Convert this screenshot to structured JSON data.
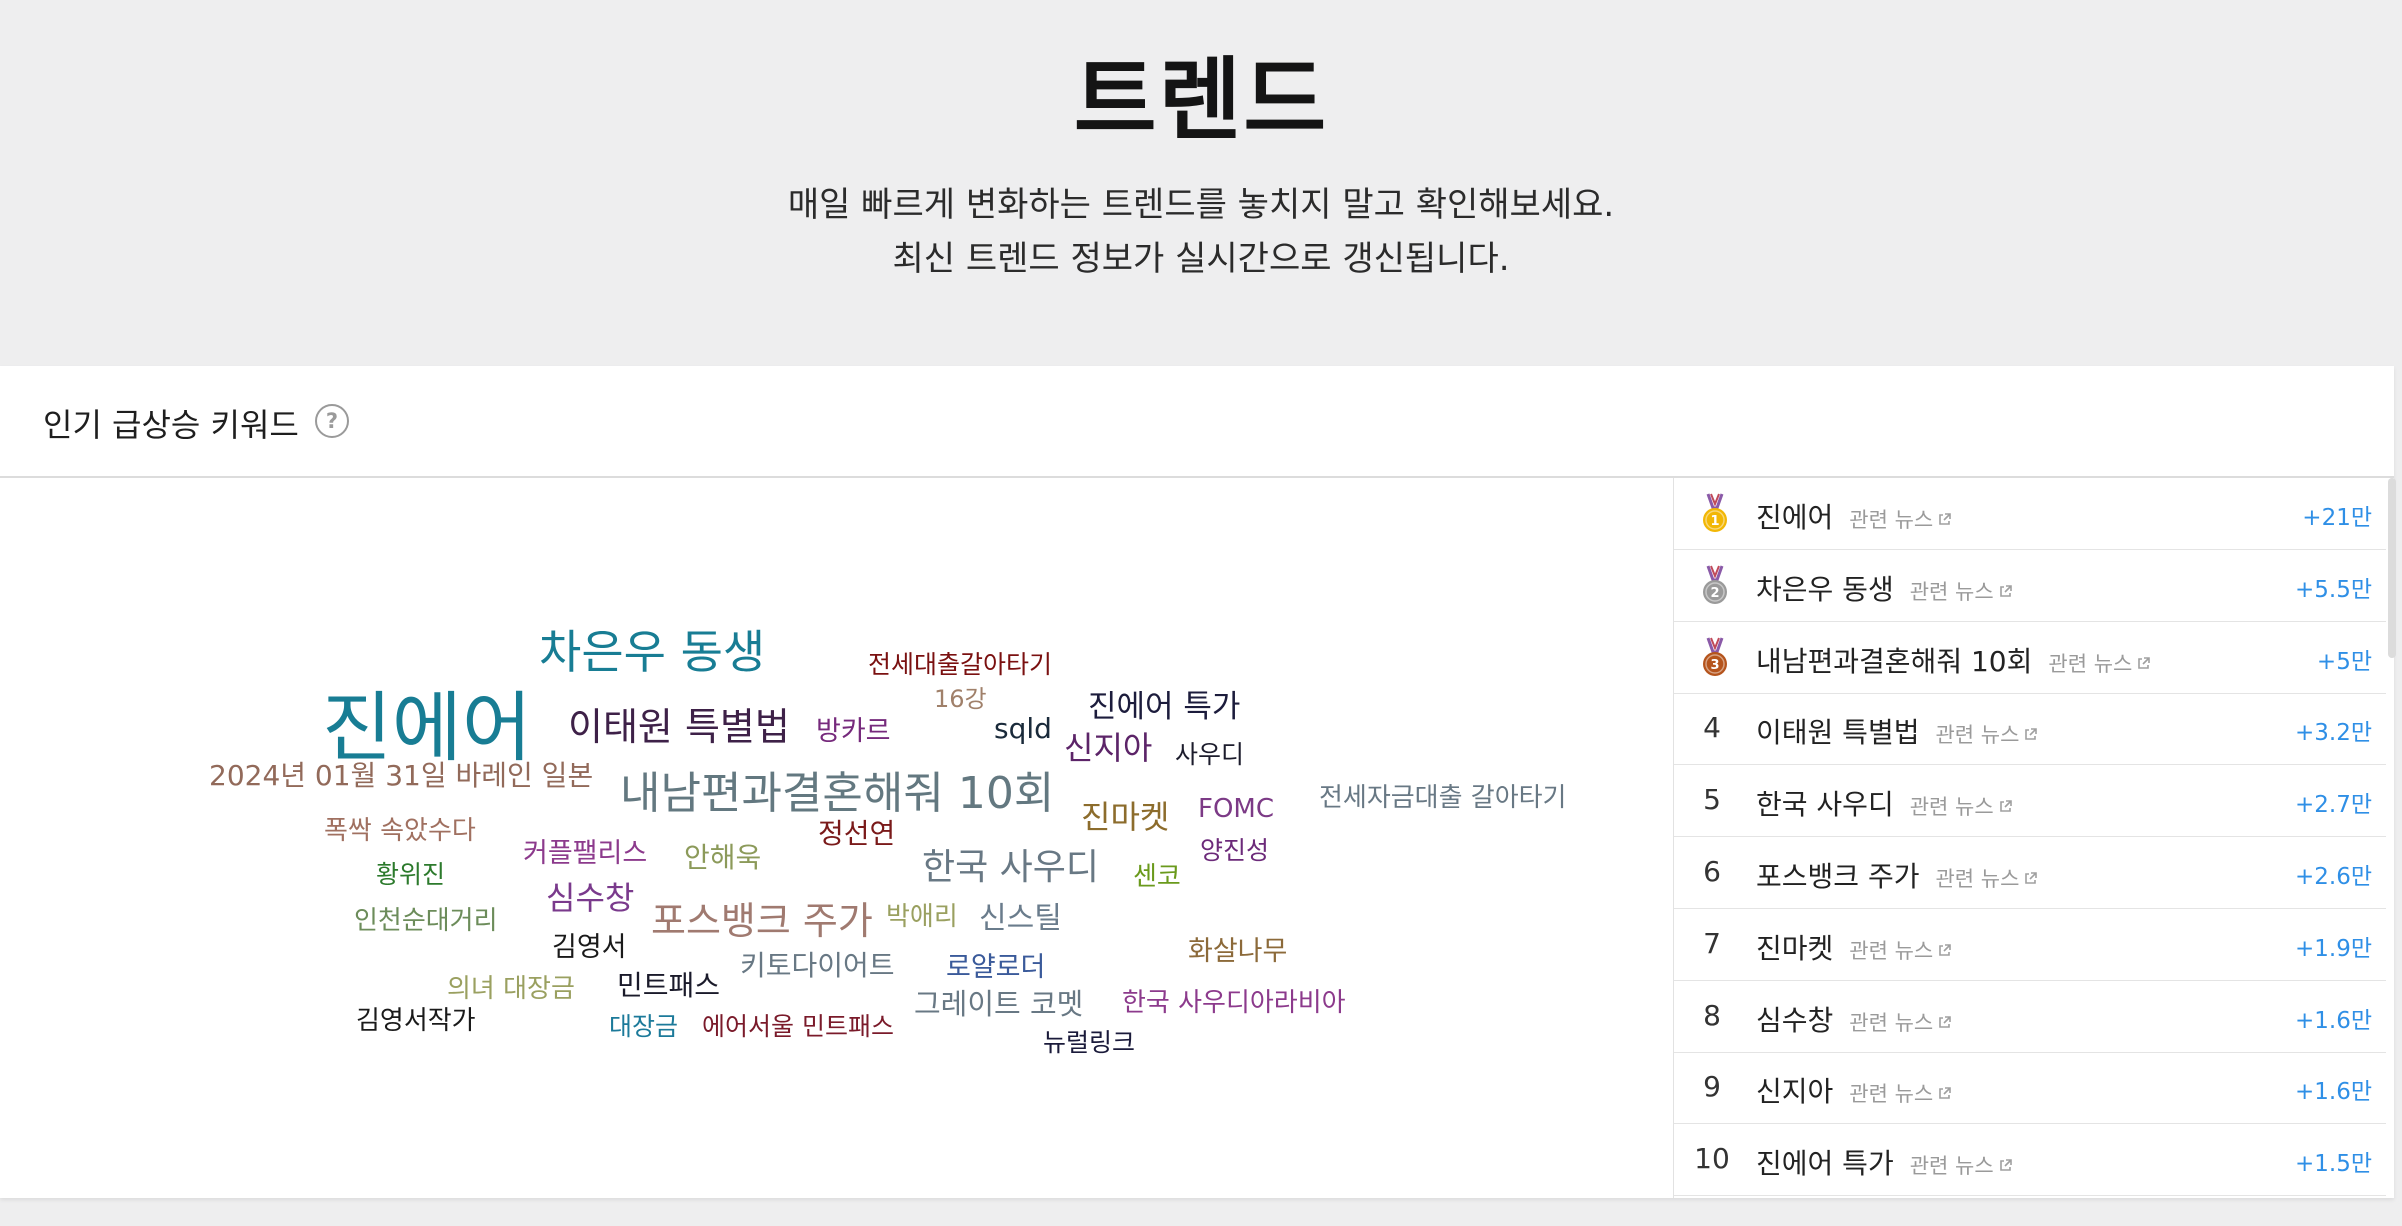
{
  "hero": {
    "title": "트렌드",
    "subtitle_line1": "매일 빠르게 변화하는 트렌드를 놓치지 말고 확인해보세요.",
    "subtitle_line2": "최신 트렌드 정보가 실시간으로 갱신됩니다."
  },
  "panel": {
    "title": "인기 급상승 키워드",
    "help_symbol": "?"
  },
  "word_cloud": [
    {
      "text": "진에어",
      "color": "#187d94"
    },
    {
      "text": "차은우 동생",
      "color": "#187d94"
    },
    {
      "text": "이태원 특별법",
      "color": "#3e2148"
    },
    {
      "text": "내남편과결혼해줘 10회",
      "color": "#637880"
    },
    {
      "text": "전세대출갈아타기",
      "color": "#7a1010"
    },
    {
      "text": "16강",
      "color": "#a0806a"
    },
    {
      "text": "sqld",
      "color": "#1a2a3a"
    },
    {
      "text": "진에어 특가",
      "color": "#1c1c3c"
    },
    {
      "text": "방카르",
      "color": "#762a7c"
    },
    {
      "text": "신지아",
      "color": "#5c2468"
    },
    {
      "text": "사우디",
      "color": "#1c1c2c"
    },
    {
      "text": "2024년 01월 31일 바레인 일본",
      "color": "#926a5a"
    },
    {
      "text": "진마켓",
      "color": "#8c6c2c"
    },
    {
      "text": "FOMC",
      "color": "#7c3a86"
    },
    {
      "text": "전세자금대출 갈아타기",
      "color": "#687884"
    },
    {
      "text": "폭싹 속았수다",
      "color": "#a07060"
    },
    {
      "text": "정선연",
      "color": "#7a1a1a"
    },
    {
      "text": "양진성",
      "color": "#6c2a7a"
    },
    {
      "text": "커플팰리스",
      "color": "#8c3a8c"
    },
    {
      "text": "안해욱",
      "color": "#8c9a5a"
    },
    {
      "text": "한국 사우디",
      "color": "#687884"
    },
    {
      "text": "황위진",
      "color": "#2c7a2c"
    },
    {
      "text": "센코",
      "color": "#6a9a1c"
    },
    {
      "text": "심수창",
      "color": "#7a3a8c"
    },
    {
      "text": "인천순대거리",
      "color": "#6c8c5a"
    },
    {
      "text": "포스뱅크 주가",
      "color": "#a07a70"
    },
    {
      "text": "박애리",
      "color": "#9aa060"
    },
    {
      "text": "신스틸",
      "color": "#6a7c8c"
    },
    {
      "text": "김영서",
      "color": "#1a1a1a"
    },
    {
      "text": "화살나무",
      "color": "#8c6a3a"
    },
    {
      "text": "키토다이어트",
      "color": "#687884"
    },
    {
      "text": "로얄로더",
      "color": "#3a5a9a"
    },
    {
      "text": "의녀 대장금",
      "color": "#9aa060"
    },
    {
      "text": "민트패스",
      "color": "#1a1a2a"
    },
    {
      "text": "그레이트 코멧",
      "color": "#687884"
    },
    {
      "text": "한국 사우디아라비아",
      "color": "#8c3a8c"
    },
    {
      "text": "김영서작가",
      "color": "#1a1a1a"
    },
    {
      "text": "대장금",
      "color": "#1c7a9a"
    },
    {
      "text": "에어서울 민트패스",
      "color": "#7a1a2a"
    },
    {
      "text": "뉴럴링크",
      "color": "#1a1a3a"
    }
  ],
  "ranking": [
    {
      "rank": "1",
      "medal": "gold-medal-icon",
      "name": "진에어",
      "news": "관련 뉴스",
      "change": "+21만"
    },
    {
      "rank": "2",
      "medal": "silver-medal-icon",
      "name": "차은우 동생",
      "news": "관련 뉴스",
      "change": "+5.5만"
    },
    {
      "rank": "3",
      "medal": "bronze-medal-icon",
      "name": "내남편과결혼해줘 10회",
      "news": "관련 뉴스",
      "change": "+5만"
    },
    {
      "rank": "4",
      "name": "이태원 특별법",
      "news": "관련 뉴스",
      "change": "+3.2만"
    },
    {
      "rank": "5",
      "name": "한국 사우디",
      "news": "관련 뉴스",
      "change": "+2.7만"
    },
    {
      "rank": "6",
      "name": "포스뱅크 주가",
      "news": "관련 뉴스",
      "change": "+2.6만"
    },
    {
      "rank": "7",
      "name": "진마켓",
      "news": "관련 뉴스",
      "change": "+1.9만"
    },
    {
      "rank": "8",
      "name": "심수창",
      "news": "관련 뉴스",
      "change": "+1.6만"
    },
    {
      "rank": "9",
      "name": "신지아",
      "news": "관련 뉴스",
      "change": "+1.6만"
    },
    {
      "rank": "10",
      "name": "진에어 특가",
      "news": "관련 뉴스",
      "change": "+1.5만"
    }
  ],
  "colors": {
    "accent_change": "#2f8fe6",
    "medal_gold": "#f2b705",
    "medal_silver": "#9a9a9a",
    "medal_bronze": "#b5541c"
  }
}
